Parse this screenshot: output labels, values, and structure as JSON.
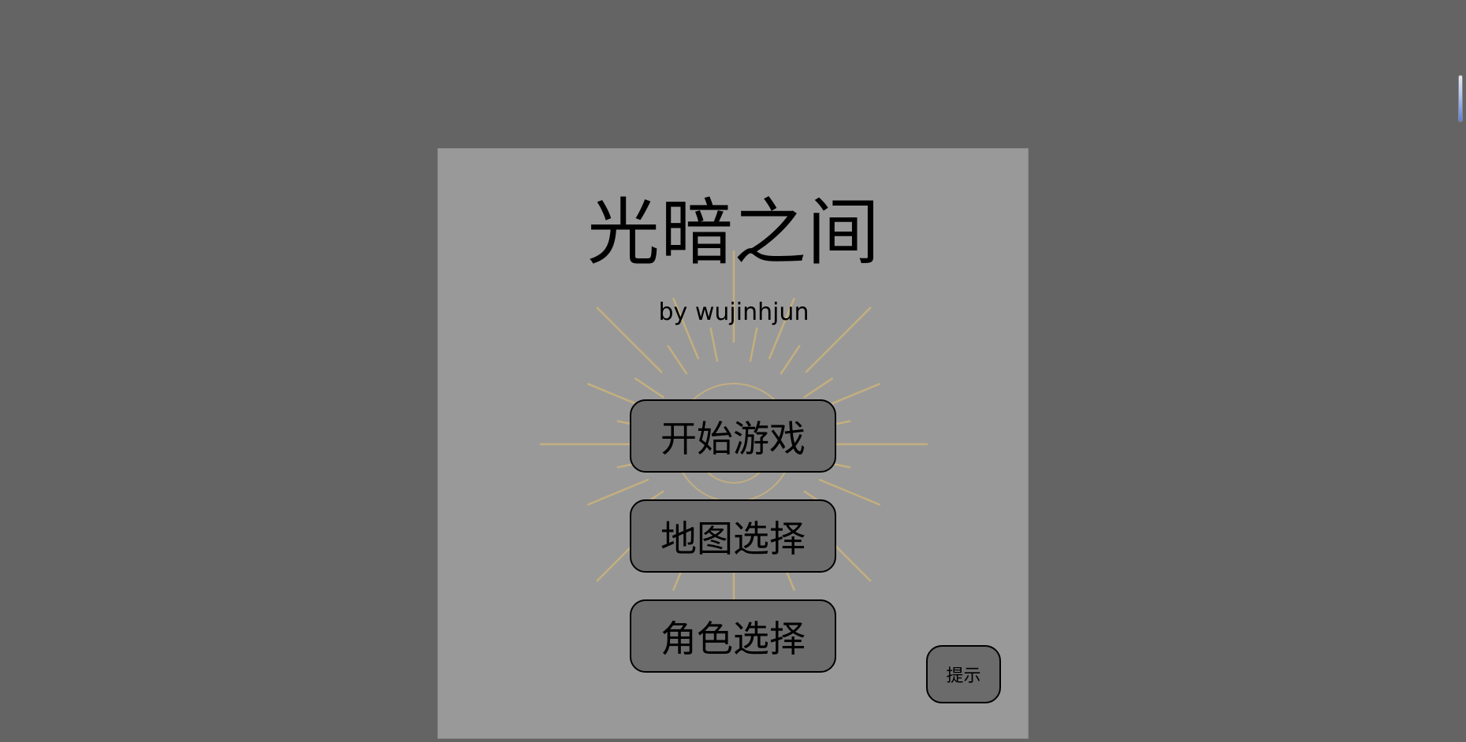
{
  "game": {
    "title": "光暗之间",
    "subtitle": "by wujinhjun",
    "menu": {
      "start_label": "开始游戏",
      "map_label": "地图选择",
      "role_label": "角色选择"
    },
    "hint_label": "提示",
    "ray_color": "#c8b27c"
  }
}
